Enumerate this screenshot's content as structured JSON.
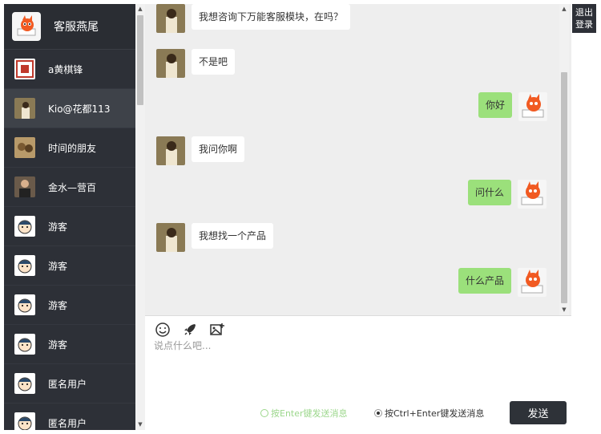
{
  "sidebar": {
    "me": {
      "name": "客服燕尾",
      "avatar": "fox-icon"
    },
    "items": [
      {
        "label": "a黄棋锋",
        "avatar": "stamp-avatar",
        "active": false
      },
      {
        "label": "Kio@花都113",
        "avatar": "photo-avatar",
        "active": true
      },
      {
        "label": "时间的朋友",
        "avatar": "photo-avatar",
        "active": false
      },
      {
        "label": "金水—营百",
        "avatar": "photo-avatar",
        "active": false
      },
      {
        "label": "游客",
        "avatar": "cartoon-avatar",
        "active": false
      },
      {
        "label": "游客",
        "avatar": "cartoon-avatar",
        "active": false
      },
      {
        "label": "游客",
        "avatar": "cartoon-avatar",
        "active": false
      },
      {
        "label": "游客",
        "avatar": "cartoon-avatar",
        "active": false
      },
      {
        "label": "匿名用户",
        "avatar": "cartoon-avatar",
        "active": false
      },
      {
        "label": "匿名用户",
        "avatar": "cartoon-avatar",
        "active": false
      }
    ]
  },
  "messages": [
    {
      "dir": "in",
      "text": "我想咨询下万能客服模块，在吗？"
    },
    {
      "dir": "in",
      "text": "不是吧"
    },
    {
      "dir": "out",
      "text": "你好"
    },
    {
      "dir": "in",
      "text": "我问你啊"
    },
    {
      "dir": "out",
      "text": "问什么"
    },
    {
      "dir": "in",
      "text": "我想找一个产品"
    },
    {
      "dir": "out",
      "text": "什么产品"
    }
  ],
  "composer": {
    "tools": [
      "smile-icon",
      "rocket-icon",
      "image-icon"
    ],
    "placeholder": "说点什么吧...",
    "option_enter": "按Enter键发送消息",
    "option_ctrl_enter": "按Ctrl+Enter键发送消息",
    "send_label": "发送"
  },
  "logout_label": "退出登录",
  "colors": {
    "sidebar": "#2d3037",
    "outgoing_bubble": "#9be07b",
    "chat_bg": "#eeeeee"
  }
}
